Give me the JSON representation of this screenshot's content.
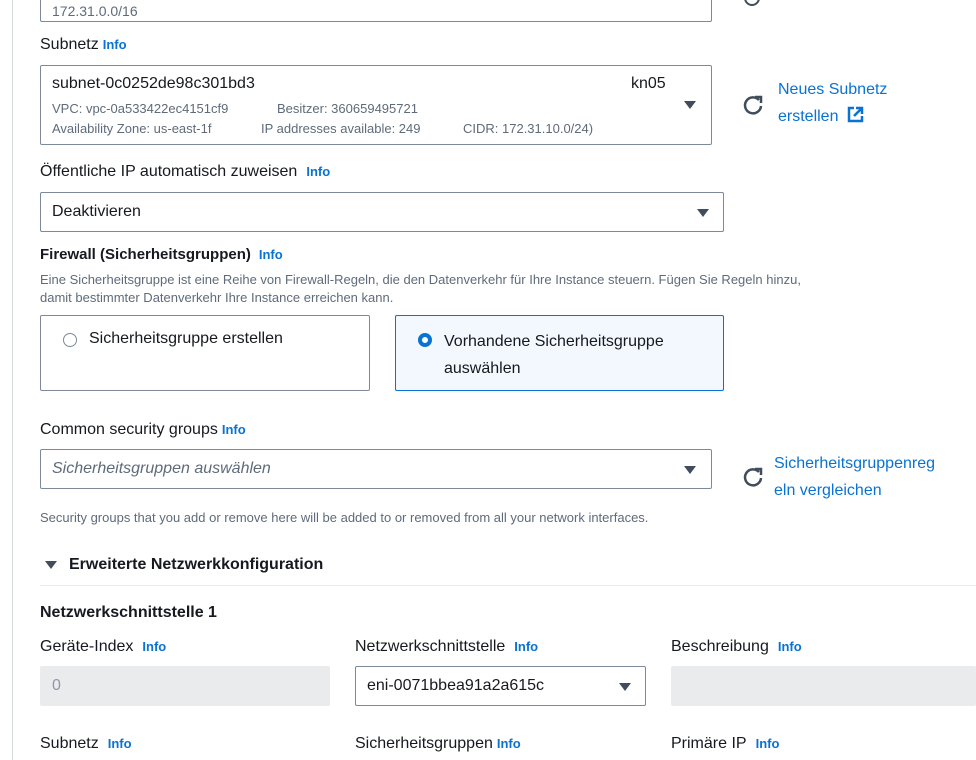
{
  "vpc_cidr_value": "172.31.0.0/16",
  "subnet": {
    "label": "Subnetz",
    "info": "Info",
    "id": "subnet-0c0252de98c301bd3",
    "name": "kn05",
    "vpc": "VPC: vpc-0a533422ec4151cf9",
    "owner": "Besitzer: 360659495721",
    "az": "Availability Zone: us-east-1f",
    "ips": "IP addresses available: 249",
    "cidr": "CIDR: 172.31.10.0/24)",
    "new_link_1": "Neues Subnetz",
    "new_link_2": "erstellen"
  },
  "public_ip": {
    "label": "Öffentliche IP automatisch zuweisen",
    "info": "Info",
    "value": "Deaktivieren"
  },
  "firewall": {
    "title": "Firewall (Sicherheitsgruppen)",
    "info": "Info",
    "desc_1": "Eine Sicherheitsgruppe ist eine Reihe von Firewall-Regeln, die den Datenverkehr für Ihre Instance steuern. Fügen Sie Regeln hinzu,",
    "desc_2": "damit bestimmter Datenverkehr Ihre Instance erreichen kann.",
    "option_create": "Sicherheitsgruppe erstellen",
    "option_existing_1": "Vorhandene Sicherheitsgruppe",
    "option_existing_2": "auswählen"
  },
  "common_sg": {
    "label": "Common security groups",
    "info": "Info",
    "placeholder": "Sicherheitsgruppen auswählen",
    "compare_link_1": "Sicherheitsgruppenreg",
    "compare_link_2": "eln vergleichen",
    "hint": "Security groups that you add or remove here will be added to or removed from all your network interfaces."
  },
  "advanced": {
    "title": "Erweiterte Netzwerkkonfiguration",
    "ni_title": "Netzwerkschnittstelle 1",
    "device_index_label": "Geräte-Index",
    "device_index_value": "0",
    "ni_label": "Netzwerkschnittstelle",
    "ni_value": "eni-0071bbea91a2a615c",
    "desc_label": "Beschreibung",
    "subnet_label": "Subnetz",
    "sg_label": "Sicherheitsgruppen",
    "primary_ip_label": "Primäre IP",
    "info": "Info"
  }
}
